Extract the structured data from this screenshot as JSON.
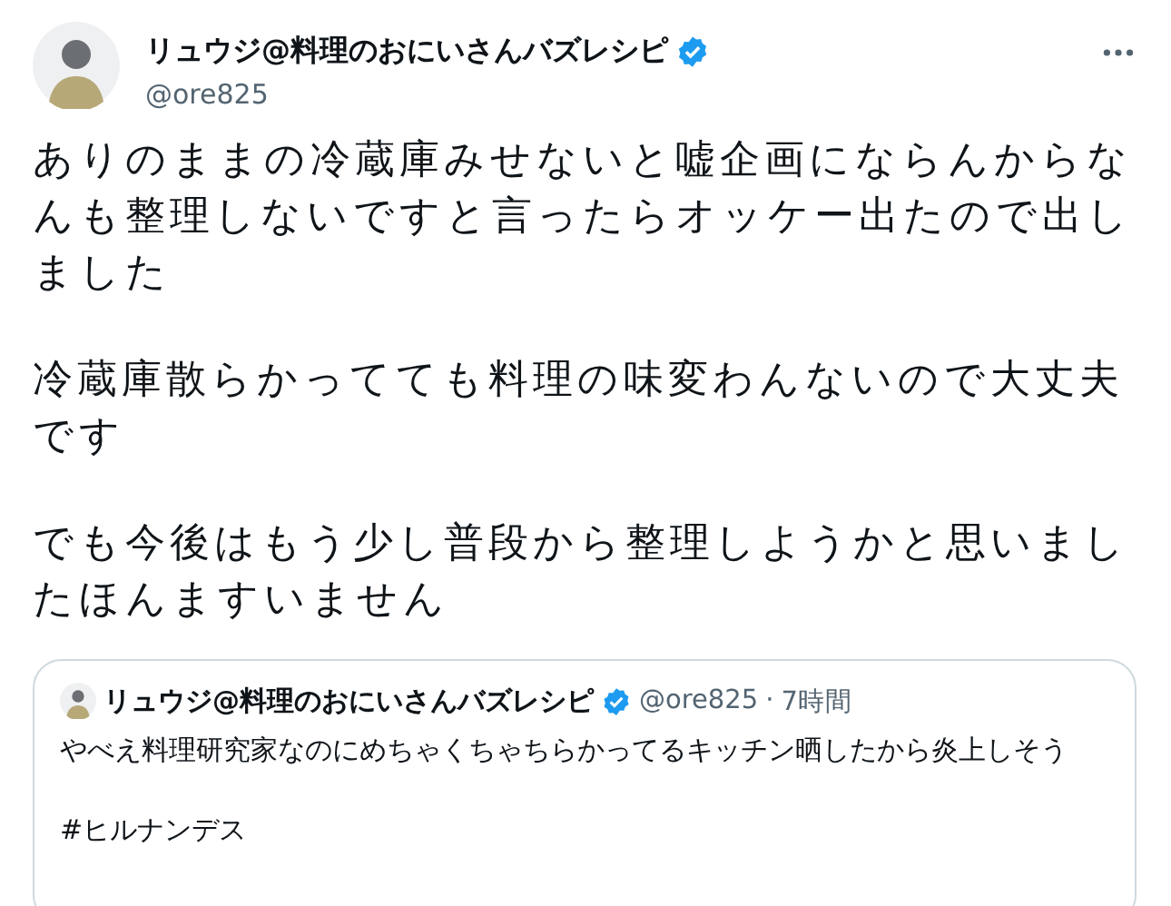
{
  "author": {
    "name": "リュウジ@料理のおにいさんバズレシピ",
    "verified": true,
    "handle": "@ore825"
  },
  "paragraphs": [
    "ありのままの冷蔵庫みせないと嘘企画にならんからなんも整理しないですと言ったらオッケー出たので出しました",
    "冷蔵庫散らかってても料理の味変わんないので大丈夫です",
    "でも今後はもう少し普段から整理しようかと思いましたほんますいません"
  ],
  "quote": {
    "name": "リュウジ@料理のおにいさんバズレシピ",
    "verified": true,
    "handle": "@ore825",
    "separator": "·",
    "time": "7時間",
    "paragraphs": [
      "やべえ料理研究家なのにめちゃくちゃちらかってるキッチン晒したから炎上しそう",
      "#ヒルナンデス"
    ]
  }
}
